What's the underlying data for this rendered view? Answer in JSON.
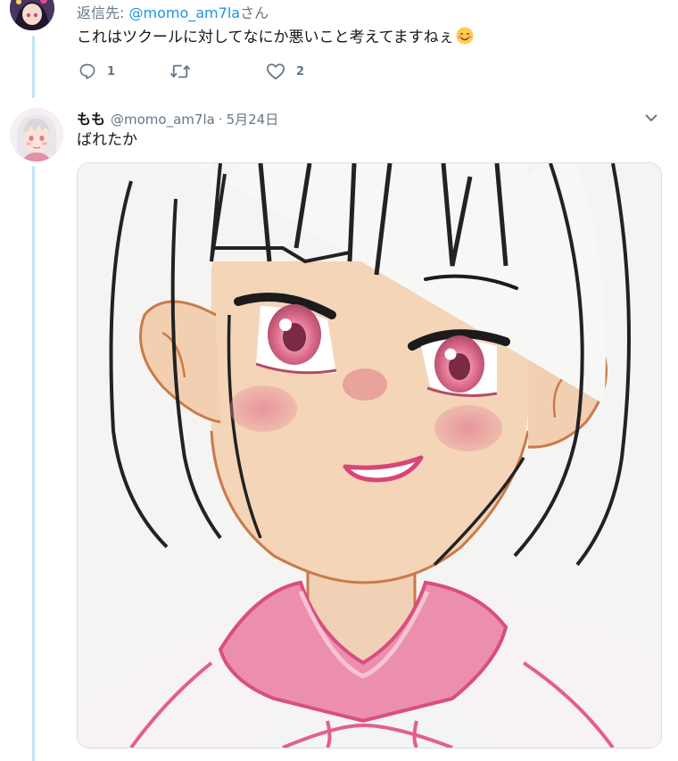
{
  "reply_tweet": {
    "reply_prefix": "返信先:",
    "reply_handle": "@momo_am7la",
    "reply_suffix": "さん",
    "text": "これはツクールに対してなにか悪いこと考えてますねぇ",
    "emoji": "smiling-face-with-smiling-eyes-icon",
    "actions": {
      "reply_count": "1",
      "retweet_count": "",
      "like_count": "2"
    }
  },
  "main_tweet": {
    "display_name": "もも",
    "screen_name": "@momo_am7la",
    "separator": "·",
    "date": "5月24日",
    "text": "ばれたか",
    "media_description": "illustration-girl-pink-hoodie"
  },
  "colors": {
    "thread_line": "#c4e6f5",
    "link": "#1b95e0",
    "secondary_text": "#657786",
    "hoodie_pink": "#e2799a"
  }
}
